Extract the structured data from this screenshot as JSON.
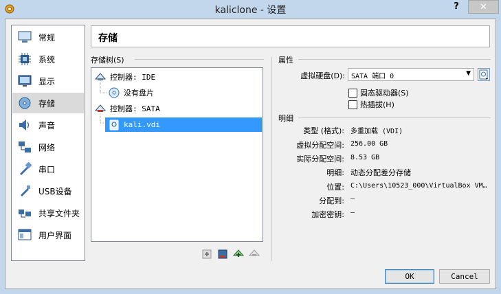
{
  "window": {
    "title": "kaliclone - 设置",
    "help": "?",
    "close": "✕"
  },
  "sidebar": {
    "items": [
      {
        "label": "常规",
        "icon": "general-icon"
      },
      {
        "label": "系统",
        "icon": "system-icon"
      },
      {
        "label": "显示",
        "icon": "display-icon"
      },
      {
        "label": "存储",
        "icon": "storage-icon",
        "selected": true
      },
      {
        "label": "声音",
        "icon": "audio-icon"
      },
      {
        "label": "网络",
        "icon": "network-icon"
      },
      {
        "label": "串口",
        "icon": "serial-port-icon"
      },
      {
        "label": "USB设备",
        "icon": "usb-icon"
      },
      {
        "label": "共享文件夹",
        "icon": "shared-folder-icon"
      },
      {
        "label": "用户界面",
        "icon": "user-interface-icon"
      }
    ]
  },
  "page": {
    "title": "存储"
  },
  "storage_tree": {
    "label": "存储树(S)",
    "nodes": [
      {
        "label": "控制器: IDE",
        "icon": "ide-controller-icon"
      },
      {
        "label": "没有盘片",
        "icon": "optical-disc-icon"
      },
      {
        "label": "控制器: SATA",
        "icon": "sata-controller-icon"
      },
      {
        "label": "kali.vdi",
        "icon": "hard-disk-icon",
        "selected": true
      }
    ]
  },
  "attributes": {
    "section_label": "属性",
    "hard_disk_label": "虚拟硬盘(D):",
    "hard_disk_value": "SATA 端口 0",
    "ssd_label": "固态驱动器(S)",
    "hotplug_label": "热插拔(H)"
  },
  "details": {
    "section_label": "明细",
    "rows": [
      {
        "label": "类型 (格式):",
        "value": "多重加载 (VDI)"
      },
      {
        "label": "虚拟分配空间:",
        "value": "256.00 GB"
      },
      {
        "label": "实际分配空间:",
        "value": "8.53 GB"
      },
      {
        "label": "明细:",
        "value": "动态分配差分存储"
      },
      {
        "label": "位置:",
        "value": "C:\\Users\\10523_000\\VirtualBox VM…"
      },
      {
        "label": "分配到:",
        "value": "—"
      },
      {
        "label": "加密密钥:",
        "value": "—"
      }
    ]
  },
  "buttons": {
    "ok": "OK",
    "cancel": "Cancel"
  },
  "colors": {
    "selection": "#3399ff",
    "frame": "#c2d6ec"
  }
}
